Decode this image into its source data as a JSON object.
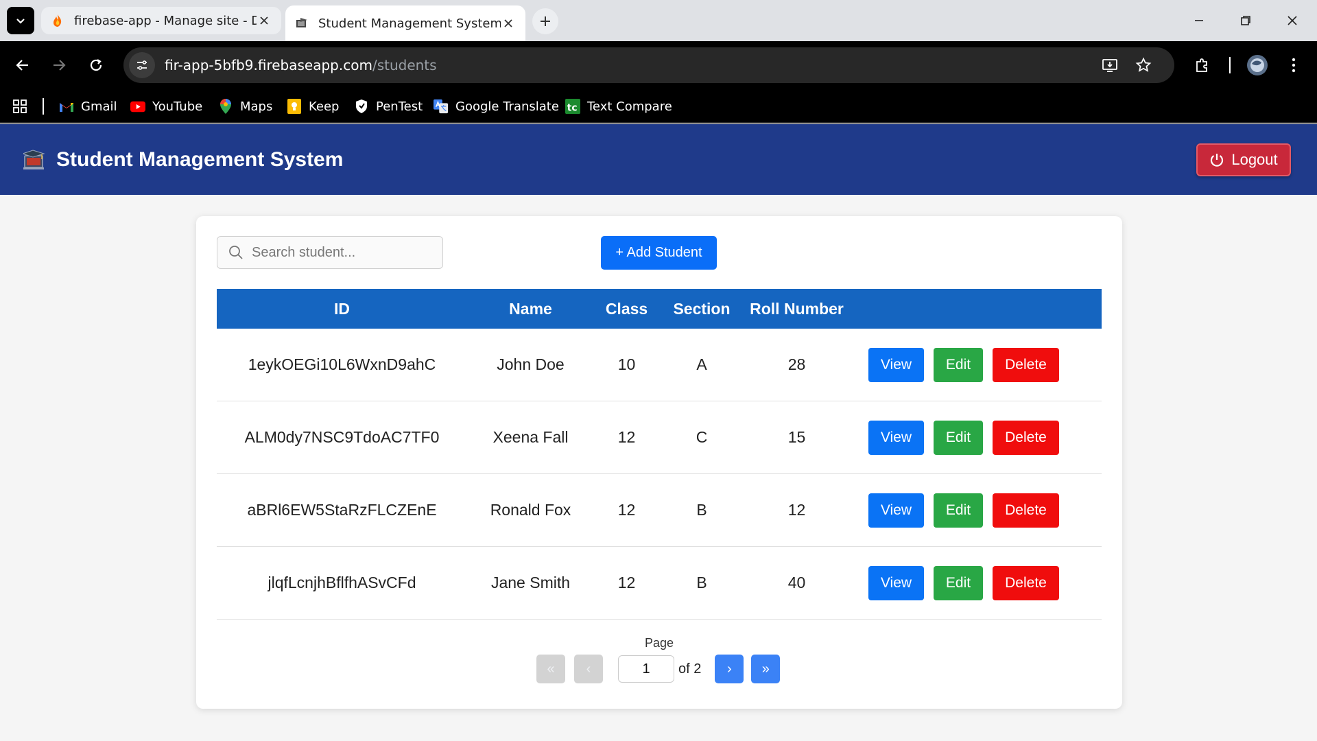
{
  "browser": {
    "tabs": [
      {
        "title": "firebase-app - Manage site - Da",
        "active": false
      },
      {
        "title": "Student Management System",
        "active": true
      }
    ],
    "url": {
      "host": "fir-app-5bfb9.firebaseapp.com",
      "path": "/students"
    },
    "bookmarks": [
      {
        "label": "Gmail",
        "icon": "gmail-icon"
      },
      {
        "label": "YouTube",
        "icon": "youtube-icon"
      },
      {
        "label": "Maps",
        "icon": "maps-icon"
      },
      {
        "label": "Keep",
        "icon": "keep-icon"
      },
      {
        "label": "PenTest",
        "icon": "pentest-icon"
      },
      {
        "label": "Google Translate",
        "icon": "translate-icon"
      },
      {
        "label": "Text Compare",
        "icon": "text-compare-icon"
      }
    ]
  },
  "app": {
    "title": "Student Management System",
    "logout_label": "Logout",
    "search_placeholder": "Search student...",
    "add_button_label": "+ Add Student",
    "columns": [
      "ID",
      "Name",
      "Class",
      "Section",
      "Roll Number",
      ""
    ],
    "rows": [
      {
        "id": "1eykOEGi10L6WxnD9ahC",
        "name": "John Doe",
        "class": "10",
        "section": "A",
        "roll": "28"
      },
      {
        "id": "ALM0dy7NSC9TdoAC7TF0",
        "name": "Xeena Fall",
        "class": "12",
        "section": "C",
        "roll": "15"
      },
      {
        "id": "aBRl6EW5StaRzFLCZEnE",
        "name": "Ronald Fox",
        "class": "12",
        "section": "B",
        "roll": "12"
      },
      {
        "id": "jlqfLcnjhBflfhASvCFd",
        "name": "Jane Smith",
        "class": "12",
        "section": "B",
        "roll": "40"
      }
    ],
    "row_actions": {
      "view": "View",
      "edit": "Edit",
      "delete": "Delete"
    },
    "pagination": {
      "label": "Page",
      "current": "1",
      "total_text": "of 2",
      "first": "«",
      "prev": "‹",
      "next": "›",
      "last": "»"
    }
  },
  "colors": {
    "app_bar": "#1f3a8a",
    "table_header": "#1565c0",
    "view_button": "#0a73f5",
    "edit_button": "#29a745",
    "delete_button": "#f00d0d",
    "logout_button": "#c8283a"
  }
}
